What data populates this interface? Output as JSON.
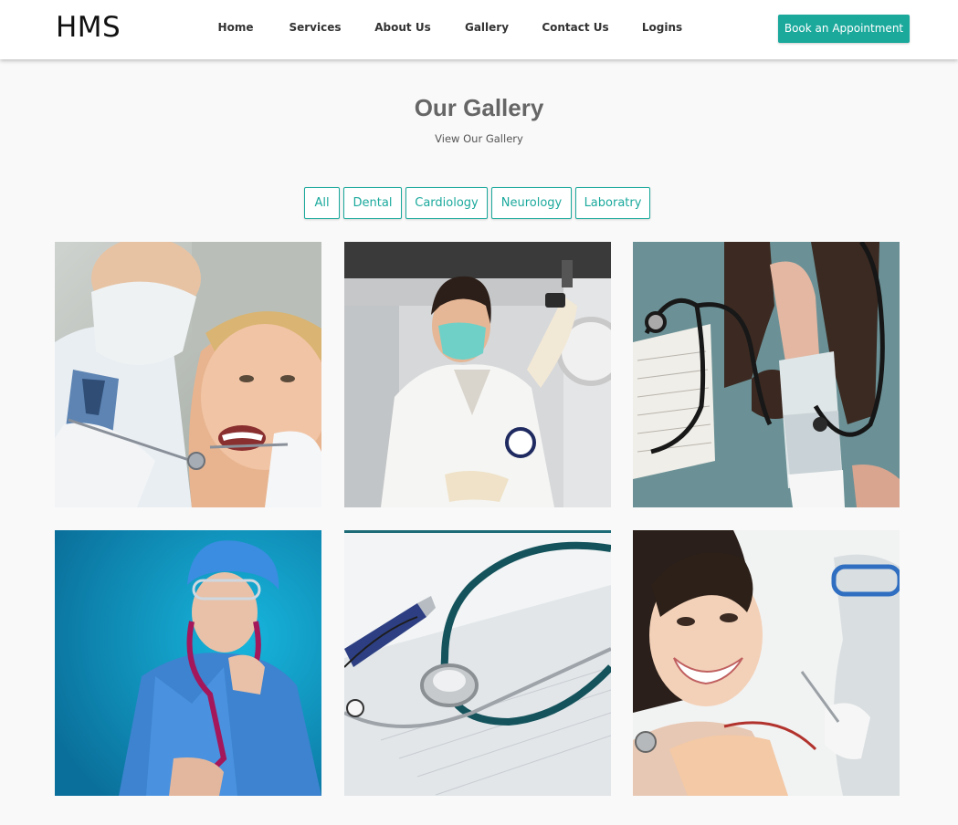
{
  "brand": {
    "logo": "HMS"
  },
  "nav": {
    "items": [
      "Home",
      "Services",
      "About Us",
      "Gallery",
      "Contact Us",
      "Logins"
    ],
    "cta_label": "Book an Appointment"
  },
  "gallery": {
    "title": "Our Gallery",
    "subtitle": "View Our Gallery",
    "filters": [
      "All",
      "Dental",
      "Cardiology",
      "Neurology",
      "Laboratry"
    ]
  },
  "colors": {
    "accent": "#1ba99c",
    "page_bg": "#f9f9f9",
    "nav_bg": "#ffffff"
  },
  "images": [
    {
      "icon": "dentist-patient-photo"
    },
    {
      "icon": "lab-scientist-photo"
    },
    {
      "icon": "blood-pressure-photo"
    },
    {
      "icon": "nurse-stethoscope-photo"
    },
    {
      "icon": "stethoscope-pen-photo"
    },
    {
      "icon": "smiling-dental-patient-photo"
    }
  ]
}
